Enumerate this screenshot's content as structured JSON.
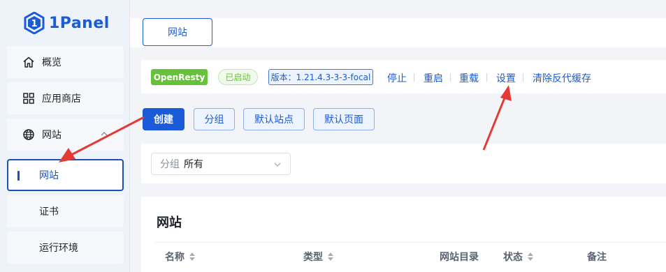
{
  "sidebar": {
    "brand": "1Panel",
    "items": [
      {
        "label": "概览",
        "icon": "home-icon"
      },
      {
        "label": "应用商店",
        "icon": "grid-icon"
      },
      {
        "label": "网站",
        "icon": "globe-icon",
        "expanded": true
      },
      {
        "label": "网站",
        "active": true
      },
      {
        "label": "证书"
      },
      {
        "label": "运行环境"
      }
    ]
  },
  "tabs": {
    "active": "网站"
  },
  "status_bar": {
    "app": "OpenResty",
    "state": "已启动",
    "version": "版本：1.21.4.3-3-3-focal",
    "actions": [
      "停止",
      "重启",
      "重载",
      "设置",
      "清除反代缓存"
    ]
  },
  "toolbar": {
    "create": "创建",
    "group": "分组",
    "default_site": "默认站点",
    "default_page": "默认页面"
  },
  "filter": {
    "label": "分组",
    "value": "所有"
  },
  "table": {
    "title": "网站",
    "columns": [
      "名称",
      "类型",
      "网站目录",
      "状态",
      "备注"
    ]
  },
  "colors": {
    "primary": "#1b5ad8",
    "success": "#67c23a",
    "annotation": "#e53935"
  }
}
